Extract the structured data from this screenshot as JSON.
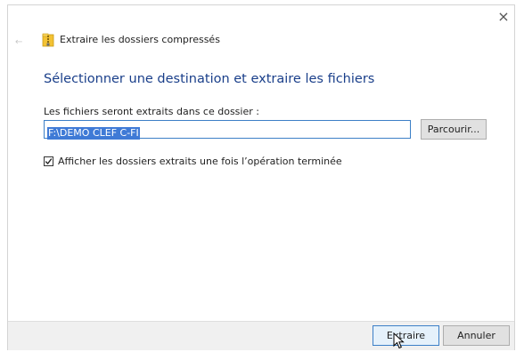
{
  "window": {
    "title": "Extraire les dossiers compressés",
    "close_glyph": "×",
    "back_glyph": "←"
  },
  "content": {
    "heading": "Sélectionner une destination et extraire les fichiers",
    "folder_label": "Les fichiers seront extraits dans ce dossier :",
    "destination_path": "F:\\DEMO CLEF C-FI",
    "browse_label": "Parcourir...",
    "show_extracted_label": "Afficher les dossiers extraits une fois l’opération terminée",
    "show_extracted_checked": true
  },
  "footer": {
    "extract_label": "Extraire",
    "cancel_label": "Annuler"
  },
  "icons": {
    "title_icon": "zip-folder-icon",
    "close": "close-icon",
    "back": "back-arrow-icon",
    "checkbox": "checkmark-icon",
    "cursor": "mouse-pointer-icon"
  },
  "colors": {
    "heading": "#1a3f8a",
    "selection": "#3f7ad6",
    "focus_border": "#3c7fc7",
    "footer_bg": "#f0f0f0"
  }
}
